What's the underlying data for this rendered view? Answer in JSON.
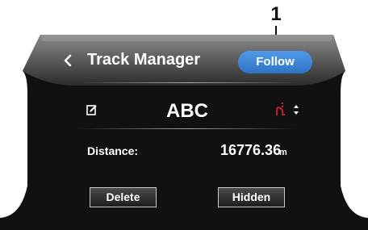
{
  "callout": {
    "number": "1"
  },
  "header": {
    "back_icon": "chevron-left-icon",
    "title": "Track Manager",
    "follow_label": "Follow"
  },
  "track": {
    "edit_icon": "edit-icon",
    "name": "ABC",
    "route_icon": "route-icon",
    "sort_icon": "sort-icon"
  },
  "details": {
    "distance_label": "Distance:",
    "distance_value": "16776.36",
    "distance_unit": "m"
  },
  "actions": {
    "delete_label": "Delete",
    "hidden_label": "Hidden"
  },
  "colors": {
    "screen_background": "#111111",
    "header_background": "#4c4c4c",
    "accent_blue": "#2f74c4",
    "route_red": "#e02020"
  }
}
